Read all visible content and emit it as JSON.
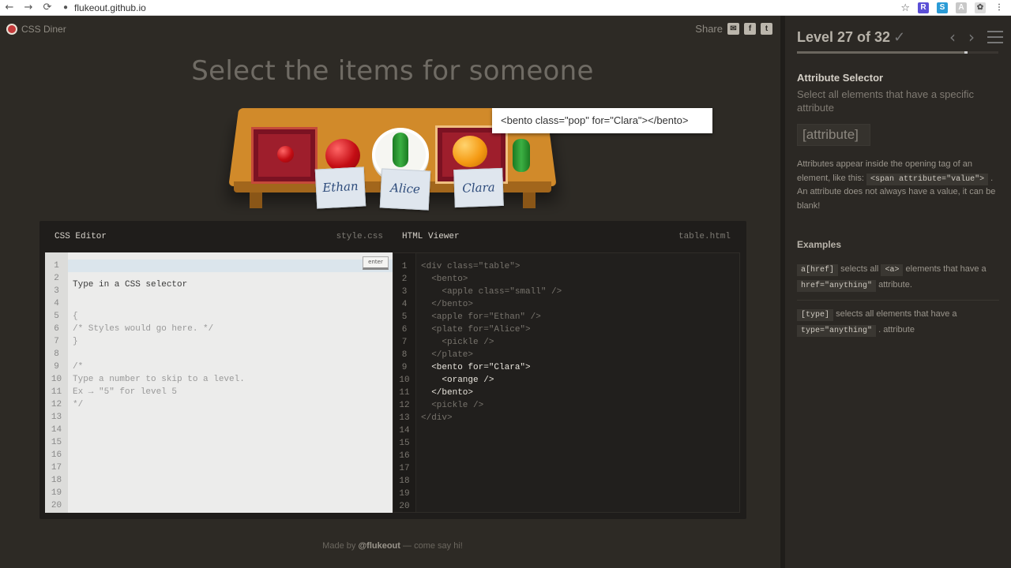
{
  "browser": {
    "url": "flukeout.github.io",
    "back": "←",
    "forward": "→",
    "reload": "⟳",
    "lock": "🔒",
    "star": "☆"
  },
  "app": {
    "name": "CSS Diner",
    "share_label": "Share"
  },
  "order_text": "Select the items for someone",
  "tooltip": "<bento class=\"pop\" for=\"Clara\"></bento>",
  "scene": {
    "tags": [
      "Ethan",
      "Alice",
      "Clara"
    ]
  },
  "css_editor": {
    "title": "CSS Editor",
    "filename": "style.css",
    "enter_label": "enter",
    "line_numbers": [
      "1",
      "2",
      "3",
      "4",
      "5",
      "6",
      "7",
      "8",
      "9",
      "10",
      "11",
      "12",
      "13",
      "14",
      "15",
      "16",
      "17",
      "18",
      "19",
      "20"
    ],
    "input_placeholder": "Type in a CSS selector",
    "lines": [
      "{",
      "/* Styles would go here. */",
      "}",
      "",
      "/*",
      "Type a number to skip to a level.",
      "Ex → \"5\" for level 5",
      "*/"
    ]
  },
  "html_viewer": {
    "title": "HTML Viewer",
    "filename": "table.html",
    "line_numbers": [
      "1",
      "2",
      "3",
      "4",
      "5",
      "6",
      "7",
      "8",
      "9",
      "10",
      "11",
      "12",
      "13",
      "14",
      "15",
      "16",
      "17",
      "18",
      "19",
      "20"
    ],
    "lines": [
      "<div class=\"table\">",
      "  <bento>",
      "    <apple class=\"small\" />",
      "  </bento>",
      "  <apple for=\"Ethan\" />",
      "  <plate for=\"Alice\">",
      "    <pickle />",
      "  </plate>",
      "  <bento for=\"Clara\">",
      "    <orange />",
      "  </bento>",
      "  <pickle />",
      "</div>"
    ]
  },
  "footer": {
    "prefix": "Made by",
    "author": "@flukeout",
    "suffix": "— come say hi!"
  },
  "sidebar": {
    "level_text": "Level 27 of 32",
    "check": "✓",
    "prev": "‹",
    "next": "›",
    "progress": 0.84,
    "selector_name": "Attribute Selector",
    "selector_title": "Select all elements that have a specific attribute",
    "syntax": "[attribute]",
    "hint_1": "Attributes appear inside the opening tag of an element, like this:",
    "hint_code": "<span attribute=\"value\">",
    "hint_2": ". An attribute does not always have a value, it can be blank!",
    "examples_heading": "Examples",
    "ex1_code": "a[href]",
    "ex1_text_1": "selects all",
    "ex1_code2": "<a>",
    "ex1_text_2": "elements that have a",
    "ex1_code3": "href=\"anything\"",
    "ex1_text_3": "attribute.",
    "ex2_code": "[type]",
    "ex2_text_1": "selects all elements that have a",
    "ex2_code2": "type=\"anything\"",
    "ex2_text_2": ". attribute"
  },
  "colors": {
    "background": "#2d2a25",
    "sidebar": "#2b2824",
    "table": "#d18a2a",
    "bento": "#7b1222",
    "apple": "#c40d14",
    "orange": "#f59b14",
    "pickle": "#3cb043"
  }
}
